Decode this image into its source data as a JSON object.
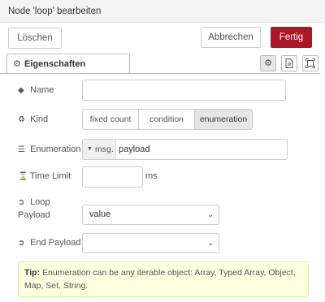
{
  "titlebar": {
    "title": "Node 'loop' bearbeiten"
  },
  "actions": {
    "delete": "Löschen",
    "cancel": "Abbrechen",
    "done": "Fertig"
  },
  "tabs": [
    {
      "label": "Eigenschaften",
      "active": true
    }
  ],
  "side_icons": [
    "gear-icon",
    "document-icon",
    "frame-icon"
  ],
  "form": {
    "name": {
      "label": "Name",
      "value": ""
    },
    "kind": {
      "label": "Kind",
      "options": [
        "fixed count",
        "condition",
        "enumeration"
      ],
      "selected": "enumeration"
    },
    "enumeration": {
      "label": "Enumeration",
      "type": "msg.",
      "value": "payload"
    },
    "time_limit": {
      "label": "Time Limit",
      "value": "",
      "unit": "ms"
    },
    "loop_payload": {
      "label_line1": "Loop",
      "label_line2": "Payload",
      "value": "value"
    },
    "end_payload": {
      "label": "End Payload",
      "value": ""
    }
  },
  "tip": {
    "prefix": "Tip:",
    "text": " Enumeration can be any iterable object: Array, Typed Array, Object, Map, Set, String."
  },
  "colors": {
    "primary": "#ad1625",
    "tip_bg": "#ffffe0",
    "selected_segment": "#e6e6e6"
  }
}
